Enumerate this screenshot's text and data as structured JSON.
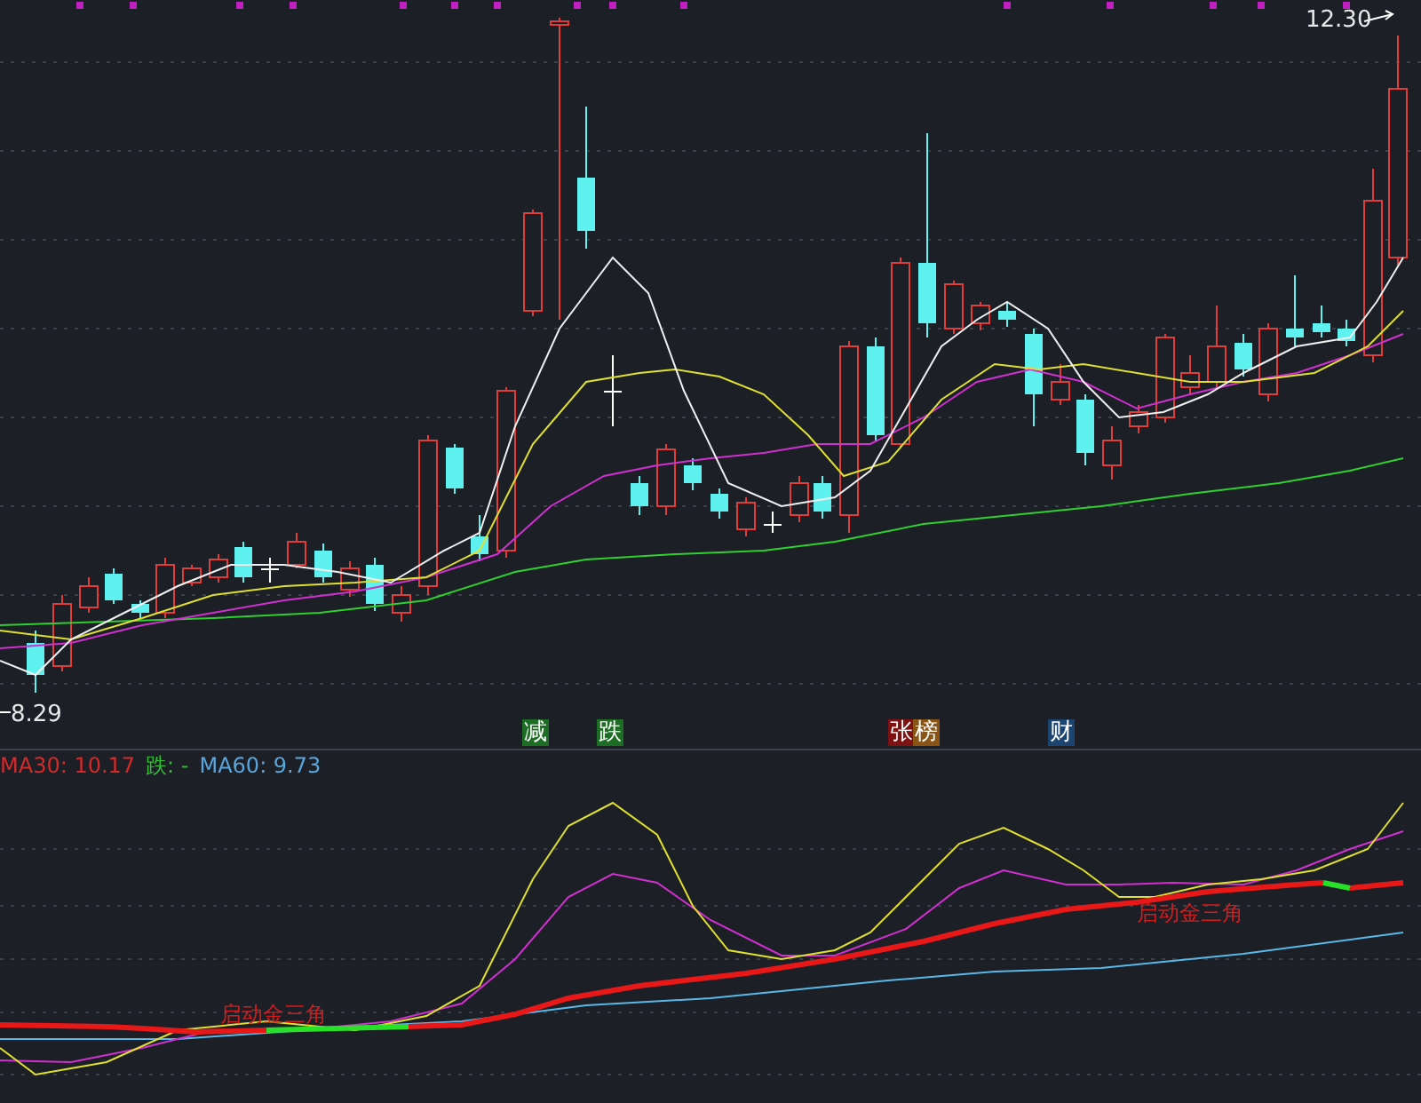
{
  "price_labels": {
    "high": "12.30",
    "low": "8.29"
  },
  "event_tags": [
    {
      "text": "减",
      "color": "#1d6e24"
    },
    {
      "text": "跌",
      "color": "#1d6e24"
    },
    {
      "text": "张",
      "color": "#7e1212"
    },
    {
      "text": "榜",
      "color": "#8a5414"
    },
    {
      "text": "财",
      "color": "#1b4470"
    }
  ],
  "legend": [
    {
      "text": "MA30: 10.17",
      "color": "#d42a2a"
    },
    {
      "text": "跌: -",
      "color": "#2fbf2f"
    },
    {
      "text": "MA60: 9.73",
      "color": "#5aa6dc"
    }
  ],
  "annotations": [
    "启动金三角",
    "启动金三角"
  ]
}
